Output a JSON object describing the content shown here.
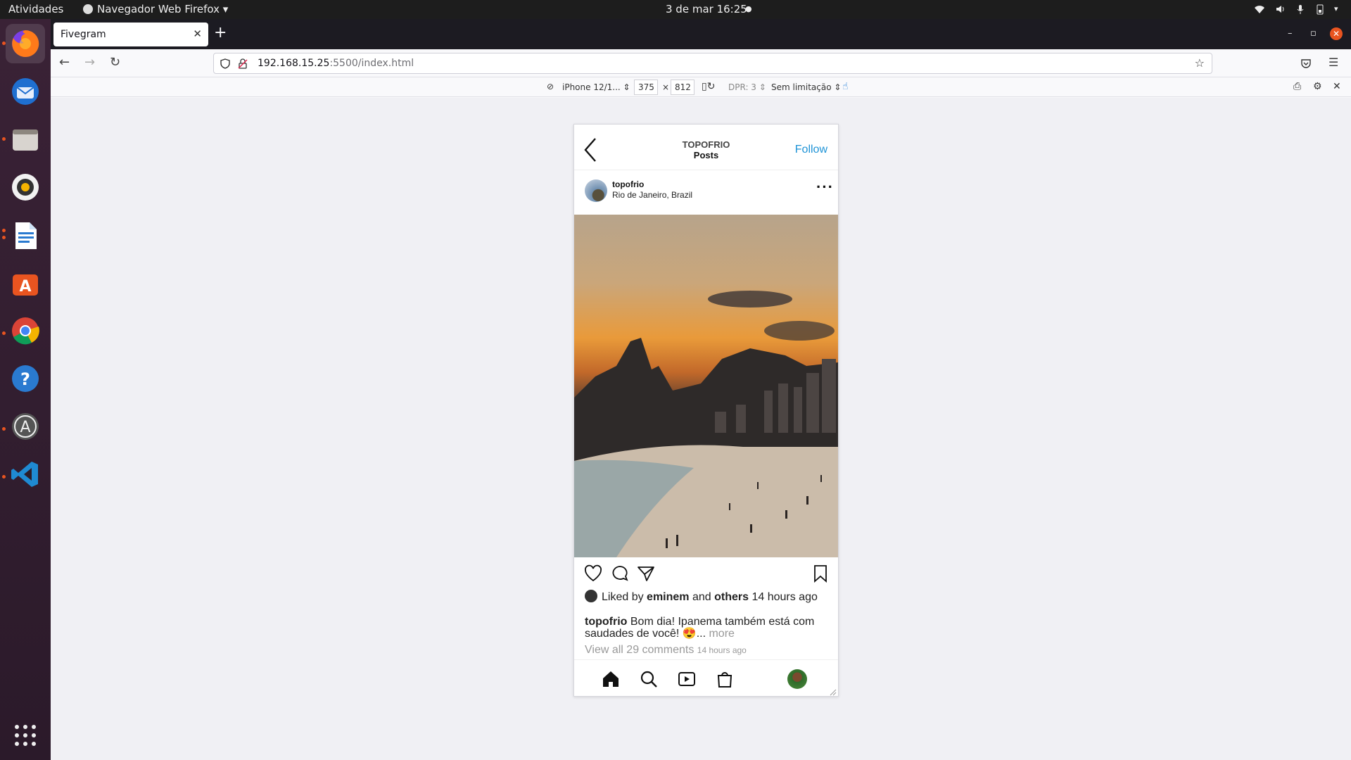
{
  "system": {
    "activities": "Atividades",
    "app_menu": "Navegador Web Firefox",
    "datetime": "3 de mar  16:25"
  },
  "dock": {
    "items": [
      "firefox-icon",
      "thunderbird-icon",
      "files-icon",
      "rhythmbox-icon",
      "writer-icon",
      "software-icon",
      "chrome-icon",
      "help-icon",
      "updater-icon",
      "vscode-icon",
      "apps-grid-icon"
    ]
  },
  "browser": {
    "tab_title": "Fivegram",
    "url_host": "192.168.15.25",
    "url_rest": ":5500/index.html"
  },
  "rdm": {
    "device": "iPhone 12/1...",
    "width": "375",
    "times": "×",
    "height": "812",
    "dpr": "DPR: 3",
    "throttle": "Sem limitação"
  },
  "app": {
    "account": "TOPOFRIO",
    "section": "Posts",
    "follow": "Follow",
    "post": {
      "username": "topofrio",
      "location": "Rio de Janeiro, Brazil",
      "likes_prefix": "Liked by ",
      "likes_user": "eminem",
      "likes_and": " and ",
      "likes_others": "others",
      "likes_time": " 14 hours ago",
      "caption_user": "topofrio",
      "caption_text": " Bom dia! Ipanema também está com saudades de você! 😍... ",
      "caption_more": "more",
      "comments": "View all 29 comments",
      "comments_time": "14 hours ago"
    }
  },
  "colors": {
    "follow_blue": "#1e93d6",
    "ubuntu_orange": "#e95420"
  }
}
